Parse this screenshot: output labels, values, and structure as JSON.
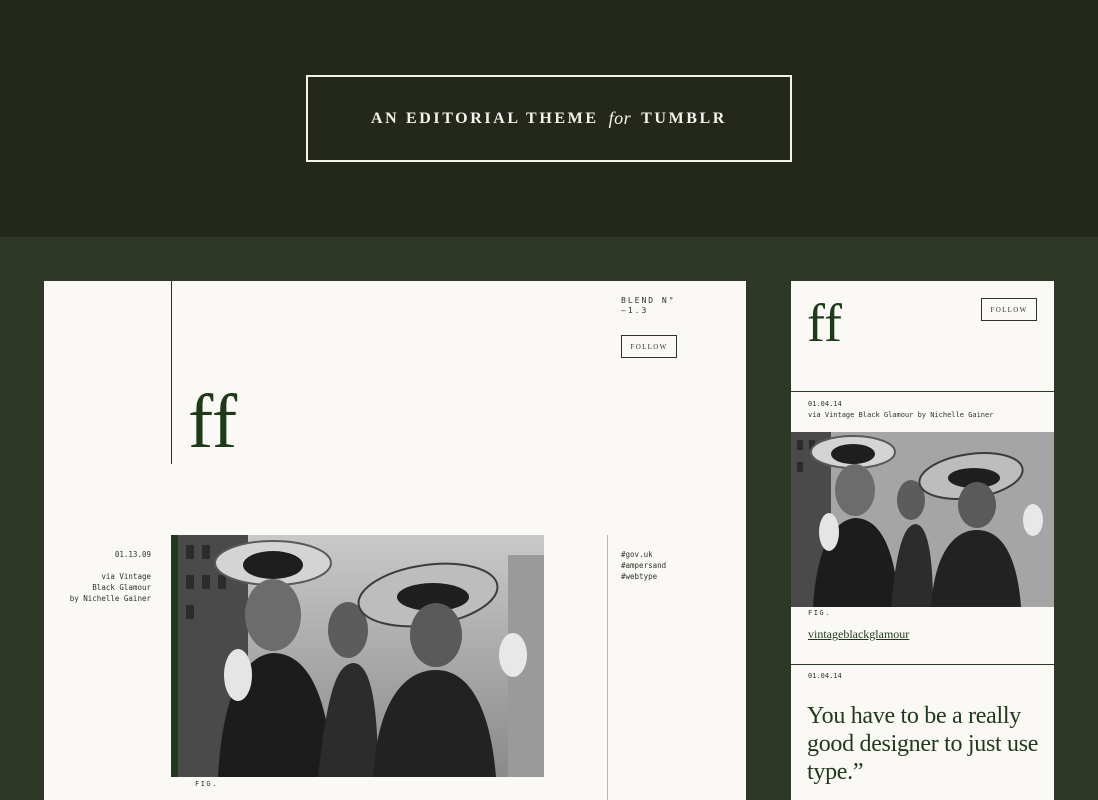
{
  "header": {
    "title_part1": "AN EDITORIAL THEME",
    "title_italic": "for",
    "title_part2": "TUMBLR"
  },
  "desktop": {
    "logo": "ff",
    "blend_line1": "BLEND N°",
    "blend_line2": "—1.3",
    "follow_label": "FOLLOW",
    "post": {
      "date": "01.13.09",
      "via_line1": "via Vintage",
      "via_line2": "Black Glamour",
      "via_line3": "by Nichelle Gainer",
      "tags": [
        "#gov.uk",
        "#ampersand",
        "#webtype"
      ],
      "fig_label": "FIG."
    }
  },
  "mobile": {
    "logo": "ff",
    "follow_label": "FOLLOW",
    "post1": {
      "date": "01.04.14",
      "via": "via Vintage Black Glamour by Nichelle Gainer",
      "fig_label": "FIG.",
      "link": "vintageblackglamour"
    },
    "post2": {
      "date": "01.04.14",
      "quote": "You have to be a really good designer to just use type.”"
    }
  },
  "colors": {
    "header_bg": "#24281c",
    "page_bg": "#2f3826",
    "panel_bg": "#faf9f6",
    "accent_green": "#1f3a1a"
  }
}
